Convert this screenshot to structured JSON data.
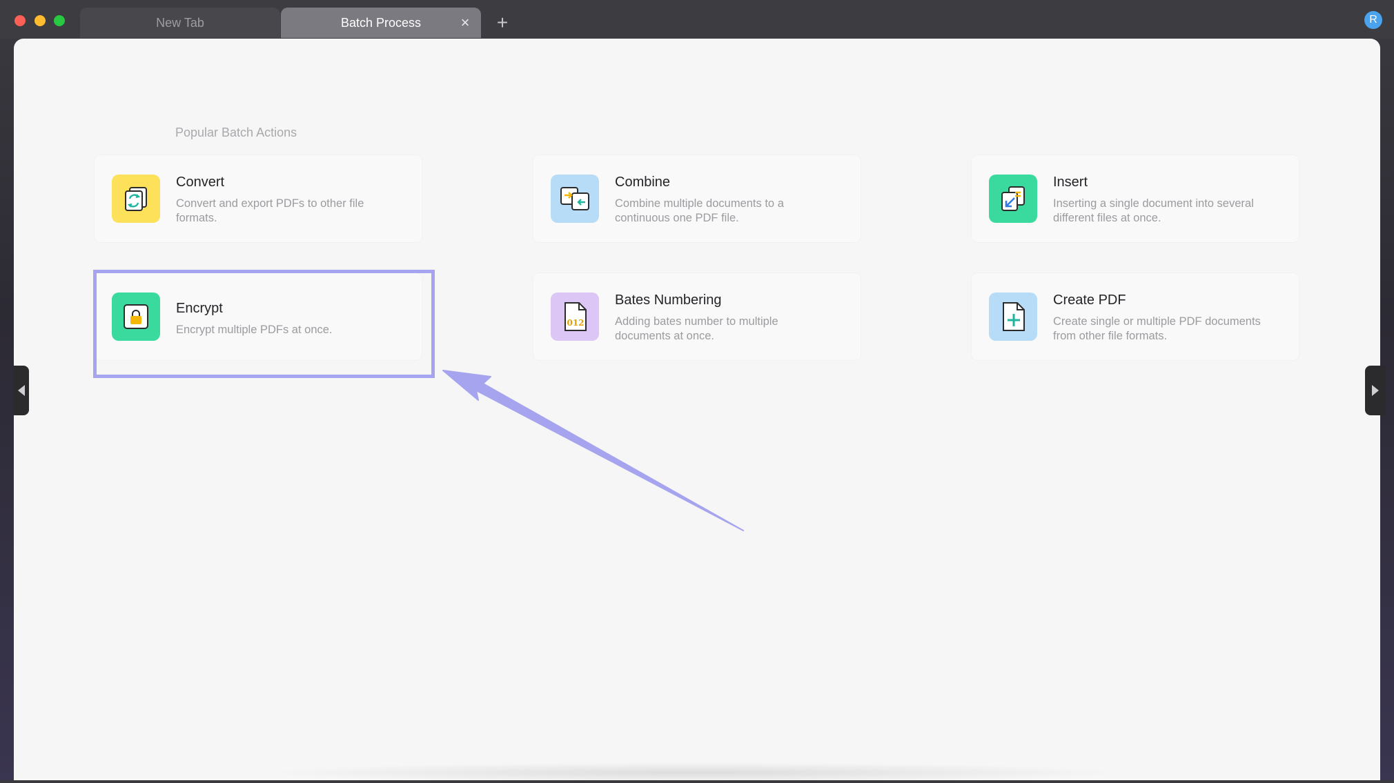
{
  "tabs": [
    {
      "label": "New Tab",
      "active": false
    },
    {
      "label": "Batch Process",
      "active": true
    }
  ],
  "tab_close_glyph": "×",
  "new_tab_glyph": "+",
  "user_avatar_initial": "R",
  "section_title": "Popular Batch Actions",
  "actions": [
    {
      "title": "Convert",
      "description": "Convert and export PDFs to other file formats.",
      "icon": "convert-icon",
      "color": "#fde15a"
    },
    {
      "title": "Combine",
      "description": "Combine multiple documents to a continuous one PDF file.",
      "icon": "combine-icon",
      "color": "#b6dcf7"
    },
    {
      "title": "Insert",
      "description": "Inserting a single document into several different files at once.",
      "icon": "insert-icon",
      "color": "#3ad99d"
    },
    {
      "title": "Encrypt",
      "description": "Encrypt multiple PDFs at once.",
      "icon": "lock-icon",
      "color": "#3ad99d"
    },
    {
      "title": "Bates Numbering",
      "description": "Adding bates number to multiple documents at once.",
      "icon": "bates-icon",
      "color": "#dcc6f6"
    },
    {
      "title": "Create PDF",
      "description": "Create single or multiple PDF documents from other file formats.",
      "icon": "create-pdf-icon",
      "color": "#b6dcf7"
    }
  ],
  "bates_icon_text": "012",
  "highlight_color": "#a6a4ef"
}
